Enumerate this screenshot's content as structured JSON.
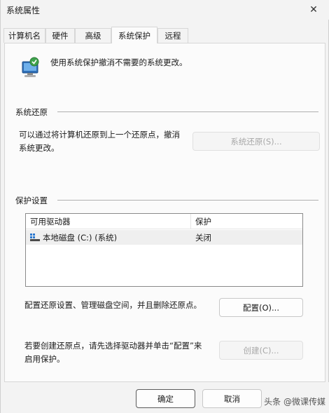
{
  "window": {
    "title": "系统属性"
  },
  "tabs": [
    {
      "label": "计算机名"
    },
    {
      "label": "硬件"
    },
    {
      "label": "高级"
    },
    {
      "label": "系统保护"
    },
    {
      "label": "远程"
    }
  ],
  "intro": {
    "text": "使用系统保护撤消不需要的系统更改。"
  },
  "restore_group": {
    "title": "系统还原",
    "line1": "可以通过将计算机还原到上一个还原点，撤消",
    "line2": "系统更改。",
    "button": "系统还原(S)..."
  },
  "protection_group": {
    "title": "保护设置",
    "columns": [
      "可用驱动器",
      "保护"
    ],
    "rows": [
      {
        "drive": "本地磁盘 (C:) (系统)",
        "protection": "关闭"
      }
    ],
    "configure_text": "配置还原设置、管理磁盘空间，并且删除还原点。",
    "configure_button": "配置(O)...",
    "create_line1": "若要创建还原点，请先选择驱动器并单击“配置”来",
    "create_line2": "启用保护。",
    "create_button": "创建(C)..."
  },
  "footer": {
    "ok": "确定",
    "cancel": "取消",
    "watermark": "头条 @微课传媒"
  }
}
